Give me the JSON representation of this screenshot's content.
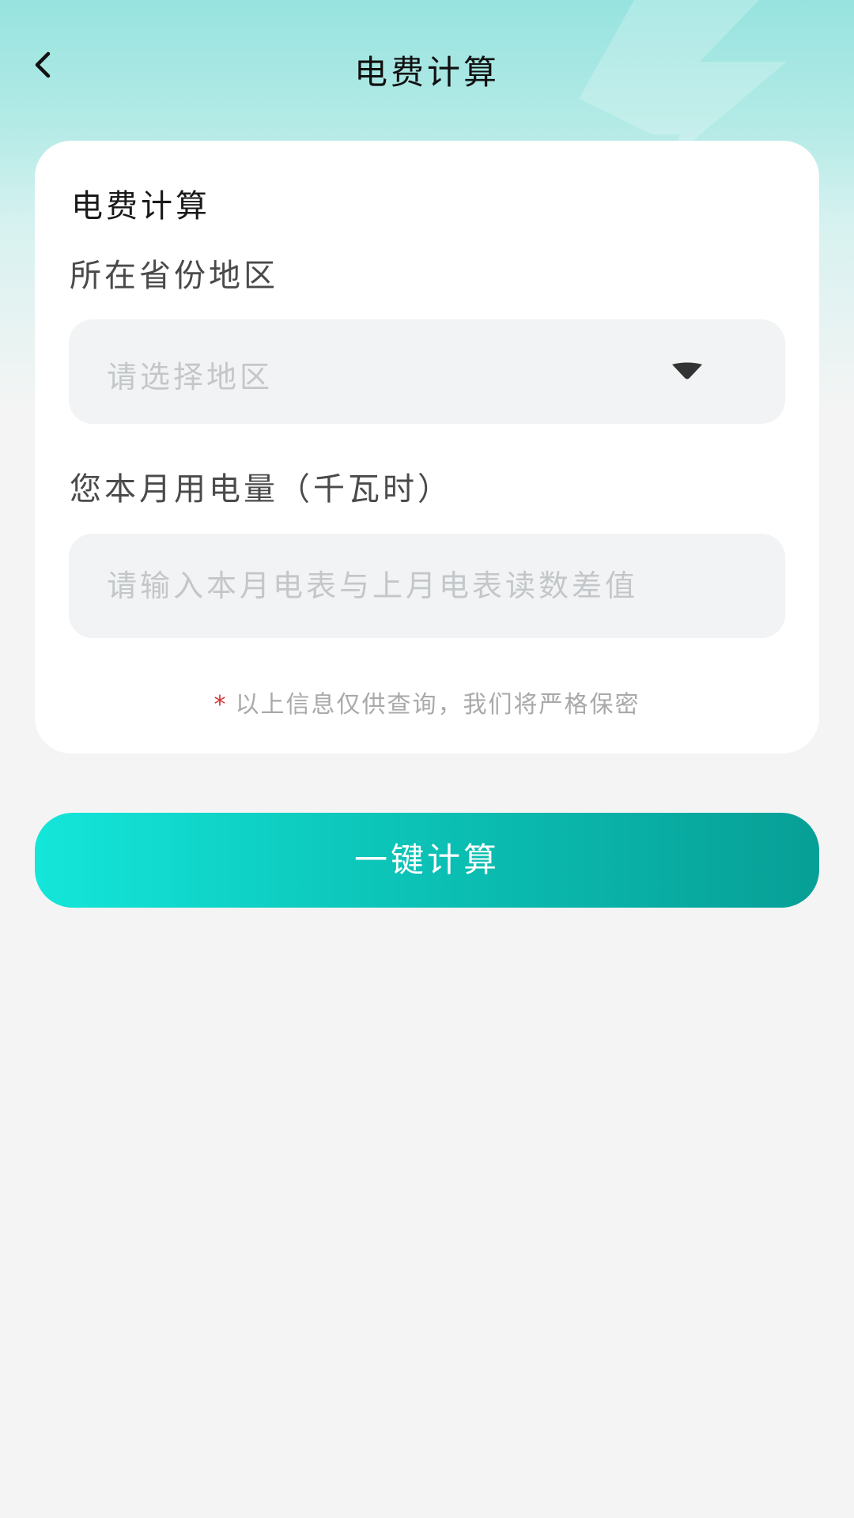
{
  "header": {
    "title": "电费计算",
    "back_icon": "chevron-left-icon"
  },
  "card": {
    "title": "电费计算",
    "region_label": "所在省份地区",
    "region_placeholder": "请选择地区",
    "region_icon": "caret-down-icon",
    "usage_label": "您本月用电量（千瓦时）",
    "usage_placeholder": "请输入本月电表与上月电表读数差值",
    "note_star": "*",
    "note_text": "以上信息仅供查询，我们将严格保密"
  },
  "action": {
    "calculate_label": "一键计算"
  },
  "colors": {
    "accent_start": "#14e6da",
    "accent_end": "#079f96",
    "header_bg": "#97e3df",
    "page_bg": "#f4f4f4",
    "required_star": "#d23636"
  }
}
